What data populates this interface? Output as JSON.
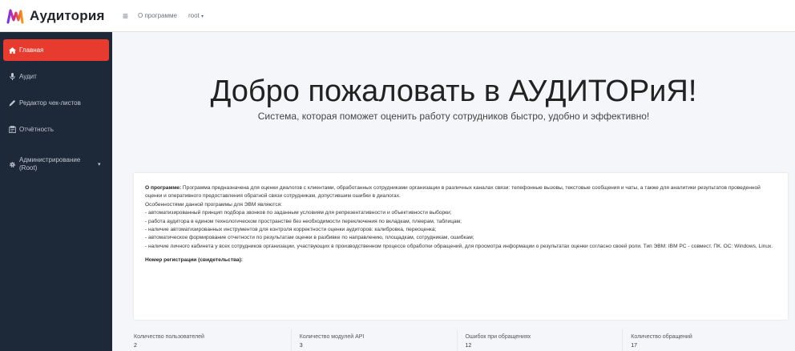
{
  "brand": {
    "name": "Аудитория",
    "logo_icon": "audio-wave-logo-icon",
    "logo_colors": [
      "#7b2ff7",
      "#e0306b",
      "#f39c12"
    ]
  },
  "colors": {
    "sidebar_bg": "#1d2939",
    "active": "#e63b2e",
    "content_bg": "#f4f6f9"
  },
  "topbar": {
    "menu_icon": "hamburger-icon",
    "about": "О программе",
    "user": "root"
  },
  "sidebar": {
    "items": [
      {
        "label": "Главная",
        "icon": "home-icon",
        "active": true
      },
      {
        "label": "Аудит",
        "icon": "microphone-icon"
      },
      {
        "label": "Редактор чек-листов",
        "icon": "pencil-icon"
      },
      {
        "label": "Отчётность",
        "icon": "report-icon"
      },
      {
        "label": "Администрирование (Root)",
        "icon": "gear-icon"
      }
    ]
  },
  "hero": {
    "title": "Добро пожаловать в АУДИТОРиЯ!",
    "subtitle": "Система, которая поможет оценить работу сотрудников быстро, удобно и эффективно!"
  },
  "about": {
    "heading": "О программе:",
    "intro": "Программа предназначена для оценки диалогов с клиентами, обработанных сотрудниками организации в различных каналах связи: телефонные вызовы, текстовые сообщения и чаты, а также для аналитики результатов проведенной оценки и оперативного предоставления обратной связи сотрудникам, допустившим ошибки в диалогах.",
    "features_title": "Особенностями данной программы для ЭВМ являются:",
    "features": [
      "- автоматизированный принцип подбора звонков по заданным условиям для репрезентативности и объективности выборки;",
      "- работа аудитора в едином технологическом пространстве без необходимости переключения по вкладкам, плеерам, таблицам;",
      "- наличие автоматизированных инструментов для контроля корректности оценки аудиторов: калибровка, переоценка;",
      "- автоматическое формирование отчетности по результатам оценки в разбивке по направлению, площадкам, сотрудникам, ошибкам;",
      "- наличие личного кабинета у всех сотрудников организации, участвующих в производственном процессе обработки обращений, для просмотра информации о результатах оценки согласно своей роли. Тип ЭВМ: IBM PC - совмест. ПК. ОС: Windows, Linux."
    ],
    "registration": "Номер регистрации (свидетельства):"
  },
  "stats": [
    {
      "label": "Количество пользователей",
      "value": "2"
    },
    {
      "label": "Количество модулей API",
      "value": "3"
    },
    {
      "label": "Ошибок при обращениях",
      "value": "12"
    },
    {
      "label": "Количество обращений",
      "value": "17"
    }
  ]
}
